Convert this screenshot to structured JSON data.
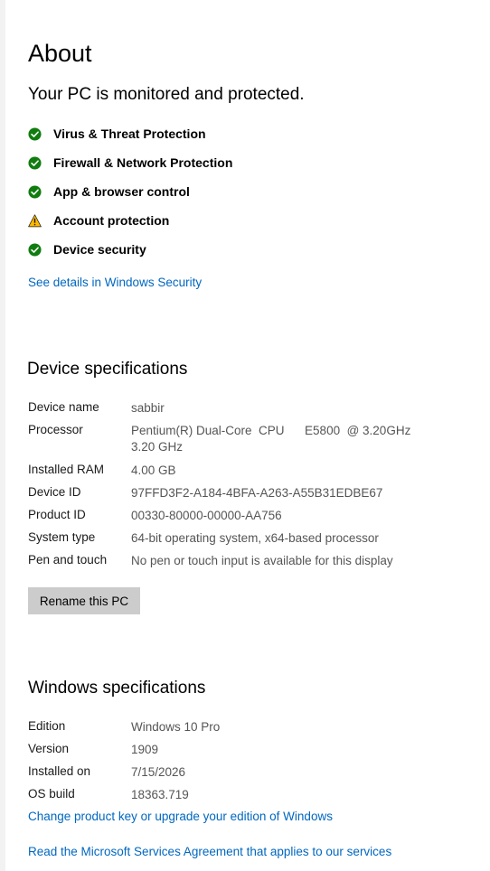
{
  "page": {
    "title": "About",
    "status_heading": "Your PC is monitored and protected."
  },
  "protection": {
    "items": [
      {
        "label": "Virus & Threat Protection",
        "status": "ok",
        "icon": "check-circle-icon",
        "color": "#107c10"
      },
      {
        "label": "Firewall & Network Protection",
        "status": "ok",
        "icon": "check-circle-icon",
        "color": "#107c10"
      },
      {
        "label": "App & browser control",
        "status": "ok",
        "icon": "check-circle-icon",
        "color": "#107c10"
      },
      {
        "label": "Account protection",
        "status": "warning",
        "icon": "warning-triangle-icon",
        "color": "#ffb900"
      },
      {
        "label": "Device security",
        "status": "ok",
        "icon": "check-circle-icon",
        "color": "#107c10"
      }
    ],
    "details_link": "See details in Windows Security"
  },
  "device_specs": {
    "heading": "Device specifications",
    "rows": [
      {
        "label": "Device name",
        "value": "sabbir"
      },
      {
        "label": "Processor",
        "value": "Pentium(R) Dual-Core  CPU      E5800  @ 3.20GHz",
        "value2": "3.20 GHz"
      },
      {
        "label": "Installed RAM",
        "value": "4.00 GB"
      },
      {
        "label": "Device ID",
        "value": "97FFD3F2-A184-4BFA-A263-A55B31EDBE67"
      },
      {
        "label": "Product ID",
        "value": "00330-80000-00000-AA756"
      },
      {
        "label": "System type",
        "value": "64-bit operating system, x64-based processor"
      },
      {
        "label": "Pen and touch",
        "value": "No pen or touch input is available for this display"
      }
    ],
    "rename_button": "Rename this PC"
  },
  "windows_specs": {
    "heading": "Windows specifications",
    "rows": [
      {
        "label": "Edition",
        "value": "Windows 10 Pro"
      },
      {
        "label": "Version",
        "value": "1909"
      },
      {
        "label": "Installed on",
        "value": "7/15/2026"
      },
      {
        "label": "OS build",
        "value": "18363.719"
      }
    ],
    "product_key_link": "Change product key or upgrade your edition of Windows",
    "services_link": "Read the Microsoft Services Agreement that applies to our services"
  },
  "colors": {
    "accent_link": "#0067c0",
    "ok_green": "#107c10",
    "warning_yellow": "#ffb900",
    "button_bg": "#cccccc"
  }
}
